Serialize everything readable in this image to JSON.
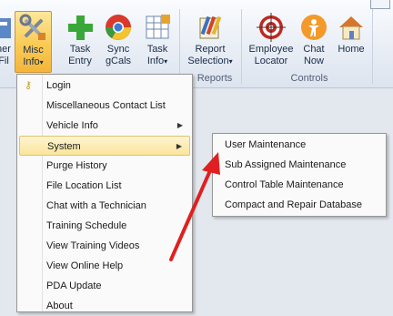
{
  "ribbon": {
    "buttons": [
      {
        "id": "customer",
        "label": "ner\nFil"
      },
      {
        "id": "misc",
        "label": "Misc\nInfo",
        "dropdown": "▾"
      },
      {
        "id": "task_entry",
        "label": "Task\nEntry"
      },
      {
        "id": "sync",
        "label": "Sync\ngCals"
      },
      {
        "id": "task_info",
        "label": "Task\nInfo",
        "dropdown": "▾"
      },
      {
        "id": "report",
        "label": "Report\nSelection",
        "dropdown": "▾"
      },
      {
        "id": "employee_locator",
        "label": "Employee\nLocator"
      },
      {
        "id": "chat",
        "label": "Chat\nNow"
      },
      {
        "id": "home",
        "label": "Home"
      }
    ],
    "groups": [
      {
        "label": "Reports"
      },
      {
        "label": "Controls"
      }
    ]
  },
  "menu": {
    "items": [
      {
        "label": "Login",
        "icon": "key-icon"
      },
      {
        "label": "Miscellaneous Contact List"
      },
      {
        "label": "Vehicle Info",
        "submenu": true
      },
      {
        "label": "System",
        "submenu": true,
        "highlighted": true
      },
      {
        "label": "Purge History"
      },
      {
        "label": "File Location List"
      },
      {
        "label": "Chat with a Technician"
      },
      {
        "label": "Training Schedule"
      },
      {
        "label": "View Training Videos"
      },
      {
        "label": "View Online Help"
      },
      {
        "label": "PDA Update"
      },
      {
        "label": "About"
      }
    ],
    "arrow_glyph": "▶"
  },
  "submenu": {
    "items": [
      {
        "label": "User Maintenance"
      },
      {
        "label": "Sub Assigned Maintenance"
      },
      {
        "label": "Control Table Maintenance"
      },
      {
        "label": "Compact and Repair Database"
      }
    ]
  },
  "annotation": {
    "color": "#e02020"
  },
  "colors": {
    "highlight": "#fbe59b",
    "menu_bg": "#fafafa",
    "ribbon_bg": "#e9eef6"
  }
}
